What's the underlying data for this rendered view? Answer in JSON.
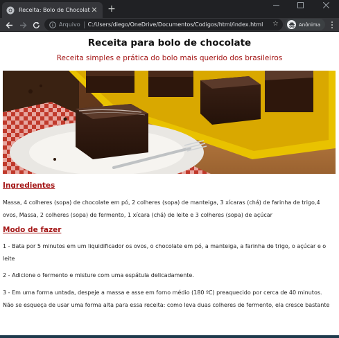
{
  "browser": {
    "tab": {
      "title": "Receita: Bolo de Chocolate",
      "close": "✕"
    },
    "new_tab": "+",
    "omnibox": {
      "info_label": "Arquivo",
      "url": "C:/Users/diego/OneDrive/Documentos/Codigos/html/index.html"
    },
    "profile_label": "Anônima"
  },
  "page": {
    "title": "Receita para bolo de chocolate",
    "subtitle": "Receita simples e prática do bolo mais querido dos brasileiros",
    "ingredients": {
      "heading": "Ingredientes",
      "text": "Massa, 4 colheres (sopa) de chocolate em pó, 2 colheres (sopa) de manteiga, 3 xícaras (chá) de farinha de trigo,4 ovos, Massa, 2 colheres (sopa) de fermento, 1 xícara (chá) de leite e 3 colheres (sopa) de açúcar"
    },
    "method": {
      "heading": "Modo de fazer",
      "steps": [
        "1 - Bata por 5 minutos em um liquidificador os ovos, o chocolate em pó, a manteiga, a farinha de trigo, o açúcar e o leite",
        "2 - Adicione o fermento e misture com uma espátula delicadamente.",
        "3 - Em uma forma untada, despeje a massa e asse em forno médio (180 ºC) preaquecido por cerca de 40 minutos. Não se esqueça de usar uma forma alta para essa receita: como leva duas colheres de fermento, ela cresce bastante"
      ]
    }
  },
  "colors": {
    "heading_red": "#a31515",
    "chrome_dark": "#202124",
    "chrome_toolbar": "#35363a"
  },
  "icons": [
    "chrome-favicon",
    "close-icon",
    "new-tab-icon",
    "minimize-icon",
    "maximize-icon",
    "window-close-icon",
    "back-icon",
    "forward-icon",
    "reload-icon",
    "info-icon",
    "star-icon",
    "incognito-icon",
    "menu-icon"
  ]
}
